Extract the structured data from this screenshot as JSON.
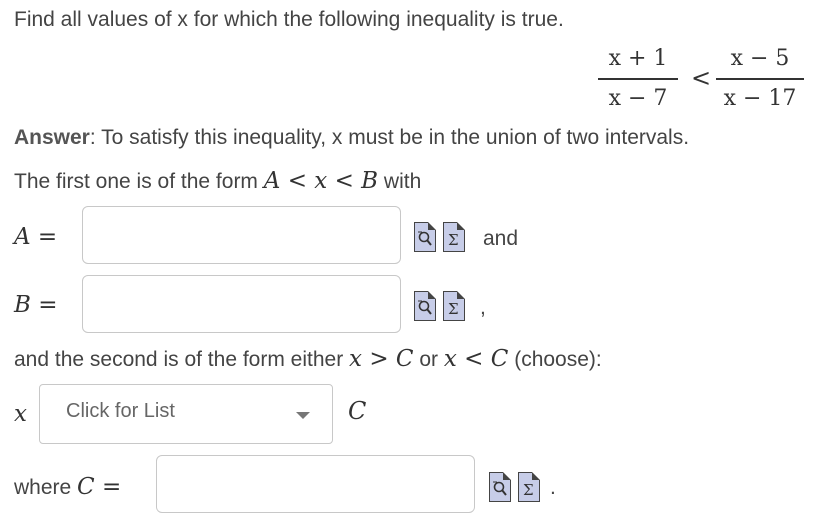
{
  "question": {
    "prompt": "Find all values of x for which the following inequality is true.",
    "lhs_num": "x + 1",
    "lhs_den": "x − 7",
    "relation": "<",
    "rhs_num": "x − 5",
    "rhs_den": "x − 17"
  },
  "answer": {
    "label": "Answer",
    "intro": ": To satisfy this inequality, x must be in the union of two intervals.",
    "first_form_prefix": "The first one is of the form",
    "first_form_expr": "A < x < B",
    "first_form_suffix": "with",
    "a_label": "A =",
    "a_value": "",
    "and_text": "and",
    "b_label": "B =",
    "b_value": "",
    "b_suffix": ",",
    "second_form_text": "and the second is of the form either",
    "second_form_expr1": "x > C",
    "second_form_or": "or",
    "second_form_expr2": "x < C",
    "second_form_choose": "(choose):",
    "select_var": "x",
    "select_placeholder": "Click for List",
    "select_const": "C",
    "c_label_prefix": "where",
    "c_label": "C =",
    "c_value": "",
    "c_suffix": "."
  },
  "icons": {
    "preview": "preview-answer-icon",
    "equation_editor": "equation-editor-icon",
    "icon_color": "#c7cde8"
  }
}
